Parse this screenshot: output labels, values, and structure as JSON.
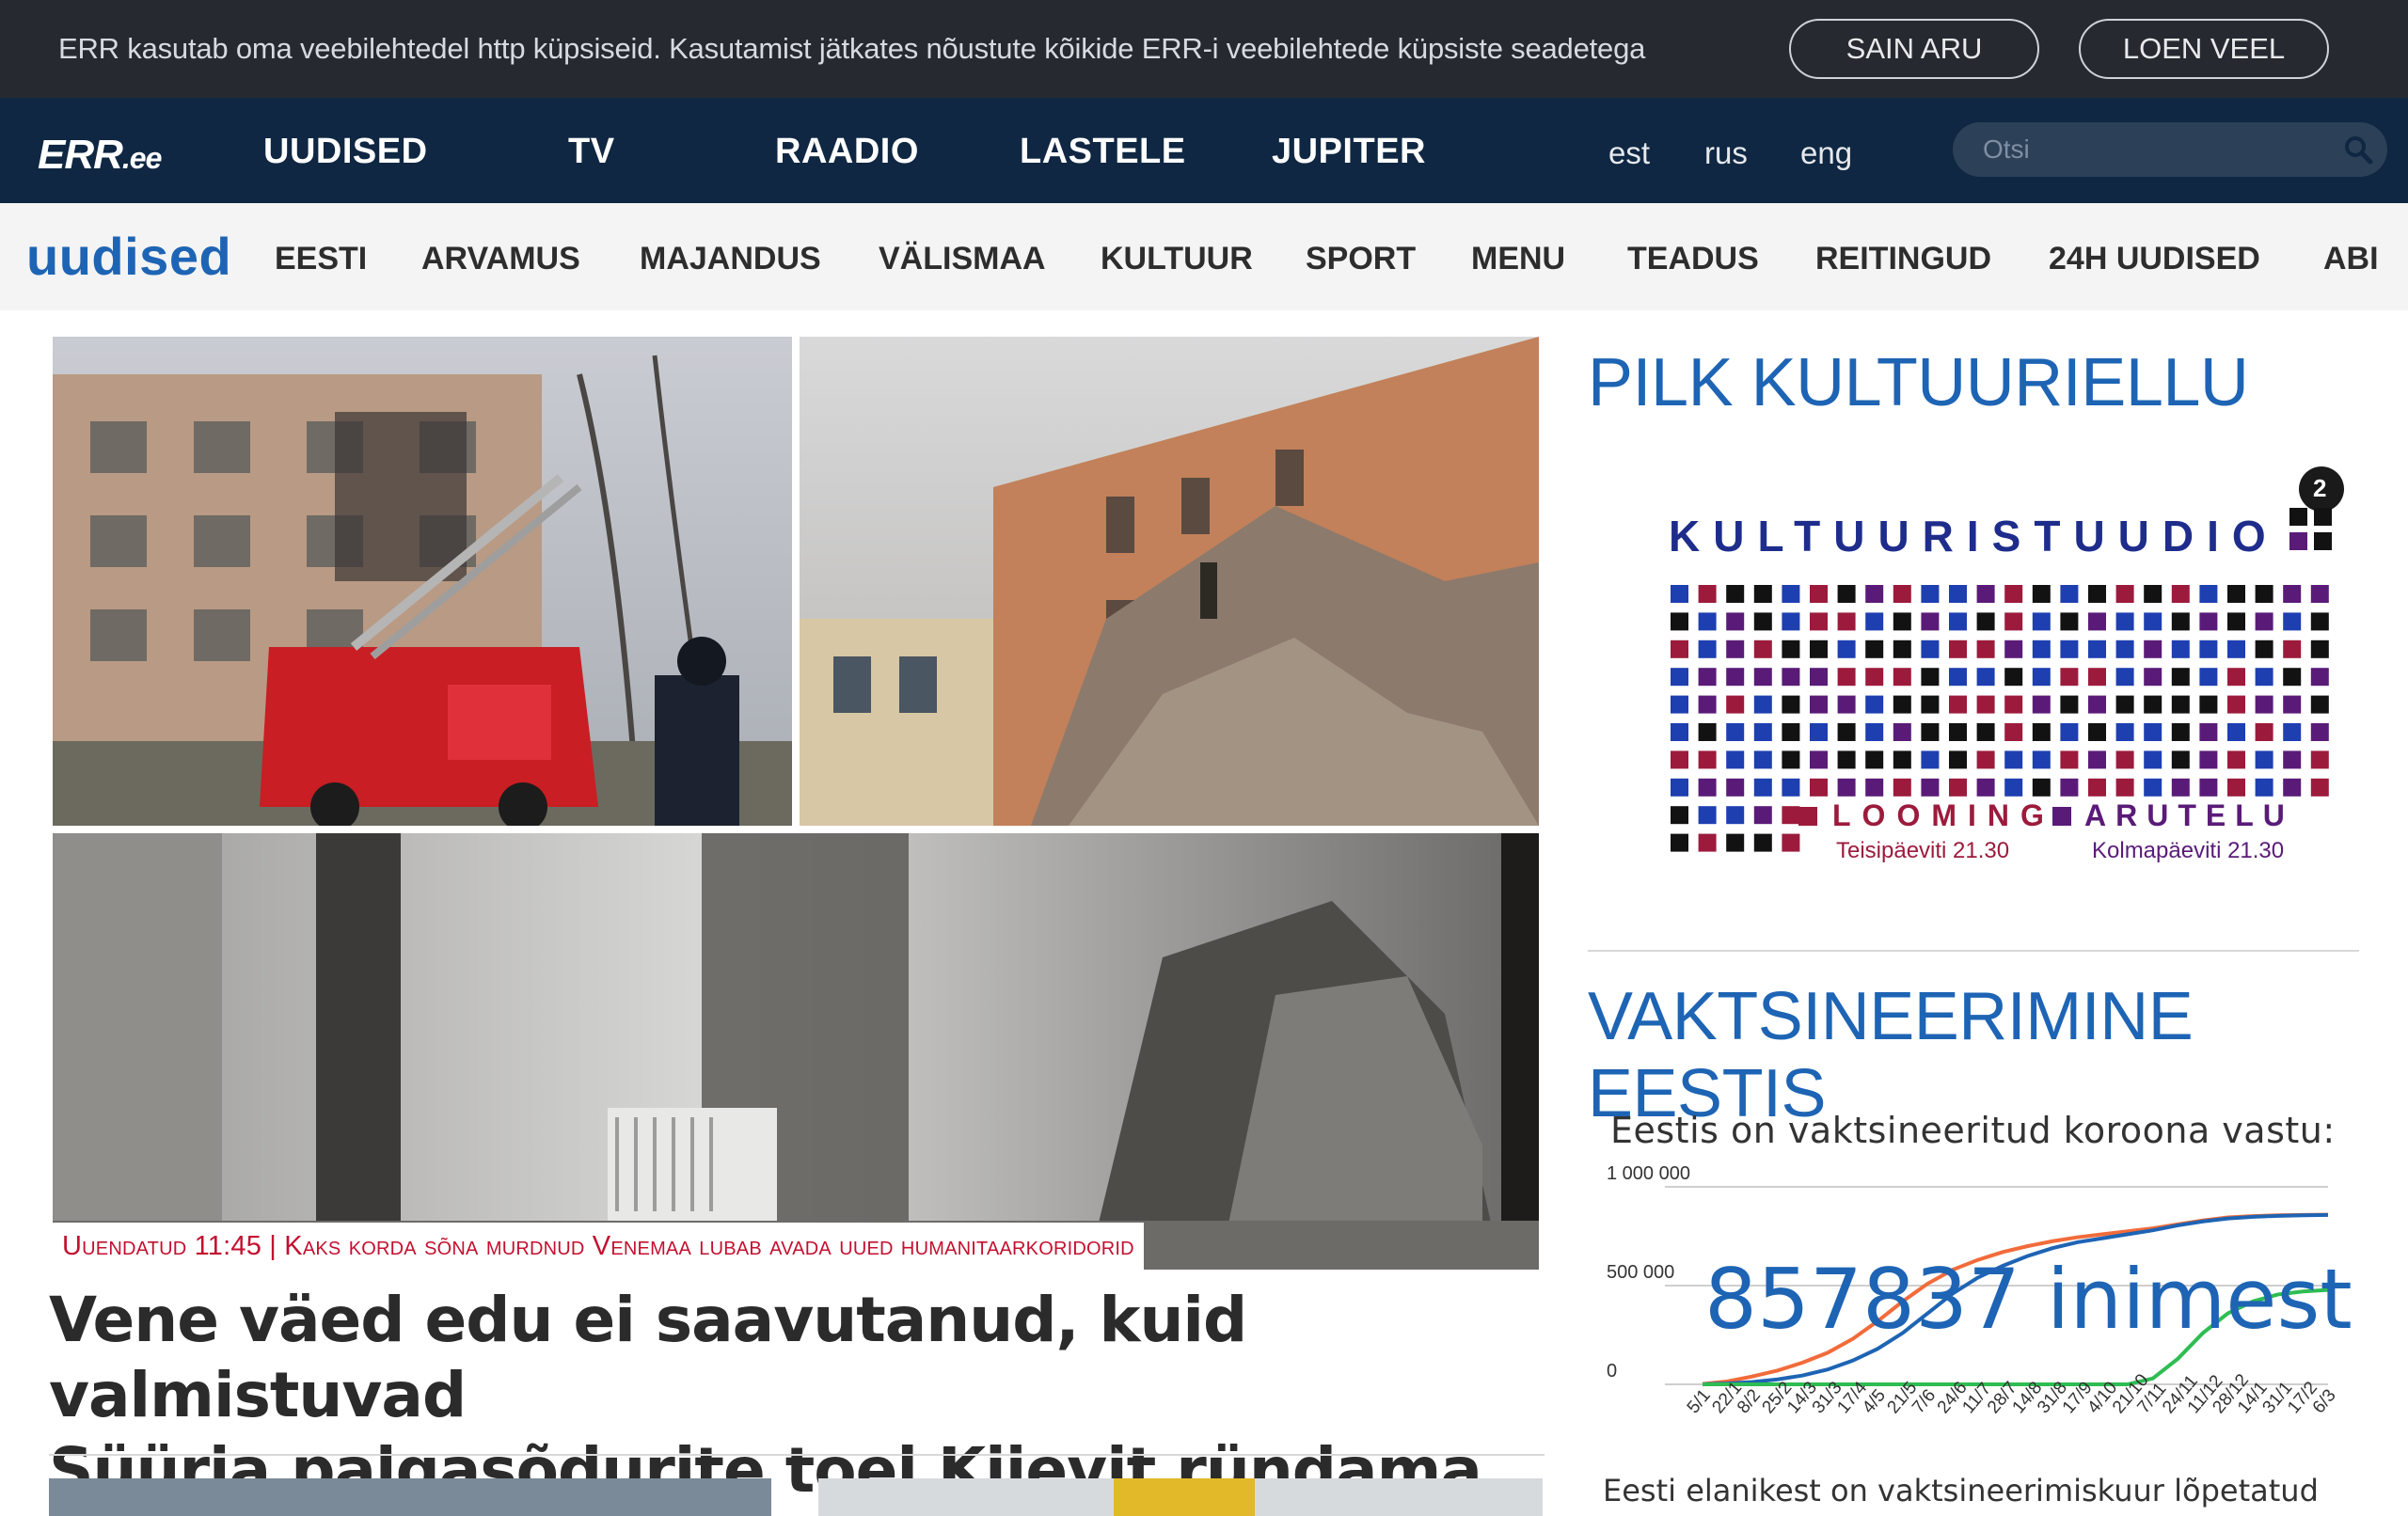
{
  "cookie": {
    "text": "ERR kasutab oma veebilehtedel http küpsiseid. Kasutamist jätkates nõustute kõikide ERR-i veebilehtede küpsiste seadetega",
    "accept_label": "SAIN ARU",
    "more_label": "LOEN VEEL"
  },
  "topnav": {
    "logo": "ERR",
    "logo_suffix": ".ee",
    "items": [
      "UUDISED",
      "TV",
      "RAADIO",
      "LASTELE",
      "JUPITER"
    ],
    "languages": [
      "est",
      "rus",
      "eng"
    ],
    "search_placeholder": "Otsi",
    "search_icon": "magnifier-icon"
  },
  "section_nav": {
    "brand": "uudised",
    "items": [
      "EESTI",
      "ARVAMUS",
      "MAJANDUS",
      "VÄLISMAA",
      "KULTUUR",
      "SPORT",
      "MENU",
      "TEADUS",
      "REITINGUD",
      "24H UUDISED",
      "ABI"
    ]
  },
  "main_story": {
    "caption": "Uuendatud 11:45 | Kaks korda sõna murdnud Venemaa lubab avada uued humanitaarkoridorid",
    "headline_line1": "Vene väed edu ei saavutanud, kuid valmistuvad",
    "headline_line2": "Süüria palgasõdurite toel Kiievit ründama",
    "image_description": "collage of damaged buildings and fire engine"
  },
  "sidebar": {
    "culture_title": "PILK KULTUURIELLU",
    "promo": {
      "channel": "ETV2",
      "title": "KULTUURISTUUDIO",
      "show1": "LOOMING",
      "show1_time": "Teisipäeviti 21.30",
      "show2": "ARUTELU",
      "show2_time": "Kolmapäeviti 21.30"
    },
    "vax_title": "VAKTSINEERIMINE EESTIS",
    "vax_subtitle": "Eestis on vaktsineeritud koroona vastu:",
    "vax_count": "857837 inimest",
    "vax_bottom": "Eesti elanikest on vaktsineerimiskuur lõpetatud"
  },
  "chart_data": {
    "type": "line",
    "title": "",
    "ylabel": "",
    "xlabel": "",
    "y_ticks": [
      "1 000 000",
      "500 000",
      "0"
    ],
    "ylim": [
      0,
      1000000
    ],
    "x": [
      "5/1",
      "22/1",
      "8/2",
      "25/2",
      "14/3",
      "31/3",
      "17/4",
      "4/5",
      "21/5",
      "7/6",
      "24/6",
      "11/7",
      "28/7",
      "14/8",
      "31/8",
      "17/9",
      "4/10",
      "21/10",
      "7/11",
      "24/11",
      "11/12",
      "28/12",
      "14/1",
      "31/1",
      "17/2",
      "6/3"
    ],
    "series": [
      {
        "color": "#f26b3a",
        "values": [
          2000,
          15000,
          40000,
          70000,
          110000,
          160000,
          230000,
          320000,
          420000,
          510000,
          580000,
          630000,
          670000,
          700000,
          725000,
          745000,
          760000,
          775000,
          790000,
          810000,
          830000,
          845000,
          852000,
          856000,
          858000,
          859000
        ]
      },
      {
        "color": "#1e64b4",
        "values": [
          500,
          4000,
          12000,
          25000,
          45000,
          75000,
          120000,
          180000,
          260000,
          360000,
          460000,
          540000,
          600000,
          650000,
          690000,
          720000,
          740000,
          760000,
          780000,
          805000,
          825000,
          840000,
          848000,
          853000,
          856000,
          857837
        ]
      },
      {
        "color": "#2ebd52",
        "values": [
          0,
          0,
          0,
          0,
          0,
          0,
          0,
          0,
          0,
          0,
          0,
          0,
          0,
          0,
          0,
          0,
          0,
          0,
          30000,
          130000,
          260000,
          360000,
          420000,
          455000,
          470000,
          478000
        ]
      }
    ]
  }
}
